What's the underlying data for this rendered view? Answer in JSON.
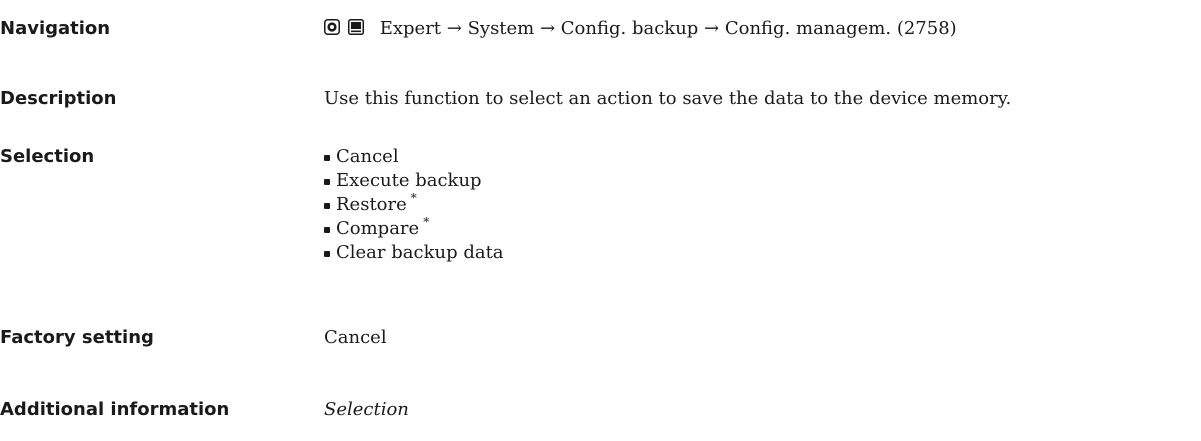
{
  "navigation": {
    "label": "Navigation",
    "icons": [
      "operating-tool-icon",
      "display-module-icon"
    ],
    "path": "Expert → System → Config. backup → Config. managem. (2758)"
  },
  "description": {
    "label": "Description",
    "text": "Use this function to select an action to save the data to the device memory."
  },
  "selection": {
    "label": "Selection",
    "items": [
      {
        "text": "Cancel",
        "mark": ""
      },
      {
        "text": "Execute backup",
        "mark": ""
      },
      {
        "text": "Restore",
        "mark": "*"
      },
      {
        "text": "Compare",
        "mark": "*"
      },
      {
        "text": "Clear backup data",
        "mark": ""
      }
    ]
  },
  "factory_setting": {
    "label": "Factory setting",
    "value": "Cancel"
  },
  "additional_information": {
    "label": "Additional information",
    "value": "Selection"
  }
}
